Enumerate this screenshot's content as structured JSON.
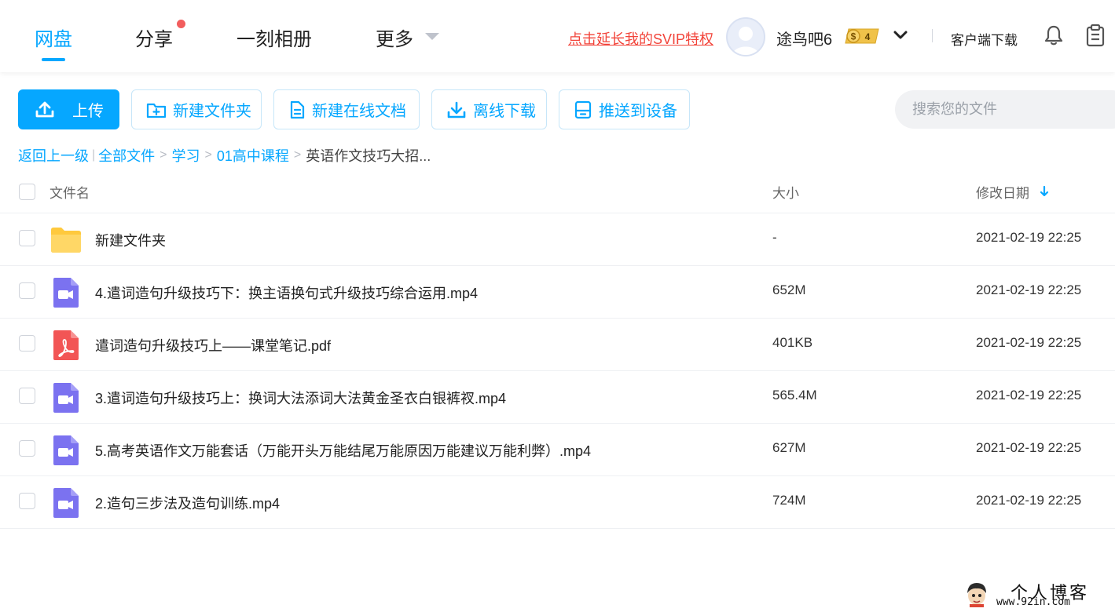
{
  "nav": {
    "tabs": [
      {
        "label": "网盘",
        "active": true
      },
      {
        "label": "分享",
        "has_dot": true
      },
      {
        "label": "一刻相册"
      },
      {
        "label": "更多"
      }
    ],
    "svip_link": "点击延长我的SVIP特权",
    "username": "途鸟吧6",
    "vip_level": "4",
    "client_download": "客户端下载",
    "accent_color": "#06a7ff"
  },
  "toolbar": {
    "upload": "上传",
    "new_folder": "新建文件夹",
    "new_doc": "新建在线文档",
    "offline_download": "离线下载",
    "push_device": "推送到设备",
    "search_placeholder": "搜索您的文件"
  },
  "breadcrumb": {
    "back": "返回上一级",
    "items": [
      "全部文件",
      "学习",
      "01高中课程"
    ],
    "current": "英语作文技巧大招..."
  },
  "table": {
    "headers": {
      "name": "文件名",
      "size": "大小",
      "modified": "修改日期"
    },
    "sort": "desc",
    "rows": [
      {
        "icon": "folder-icon",
        "name": "新建文件夹",
        "size": "-",
        "modified": "2021-02-19 22:25"
      },
      {
        "icon": "video-file-icon",
        "name": "4.遣词造句升级技巧下：换主语换句式升级技巧综合运用.mp4",
        "size": "652M",
        "modified": "2021-02-19 22:25"
      },
      {
        "icon": "pdf-file-icon",
        "name": "遣词造句升级技巧上——课堂笔记.pdf",
        "size": "401KB",
        "modified": "2021-02-19 22:25"
      },
      {
        "icon": "video-file-icon",
        "name": "3.遣词造句升级技巧上：换词大法添词大法黄金圣衣白银裤衩.mp4",
        "size": "565.4M",
        "modified": "2021-02-19 22:25"
      },
      {
        "icon": "video-file-icon",
        "name": "5.高考英语作文万能套话（万能开头万能结尾万能原因万能建议万能利弊）.mp4",
        "size": "627M",
        "modified": "2021-02-19 22:25"
      },
      {
        "icon": "video-file-icon",
        "name": "2.造句三步法及造句训练.mp4",
        "size": "724M",
        "modified": "2021-02-19 22:25"
      }
    ]
  },
  "watermark": {
    "title": "个人博客",
    "url": "www.92in.com"
  }
}
